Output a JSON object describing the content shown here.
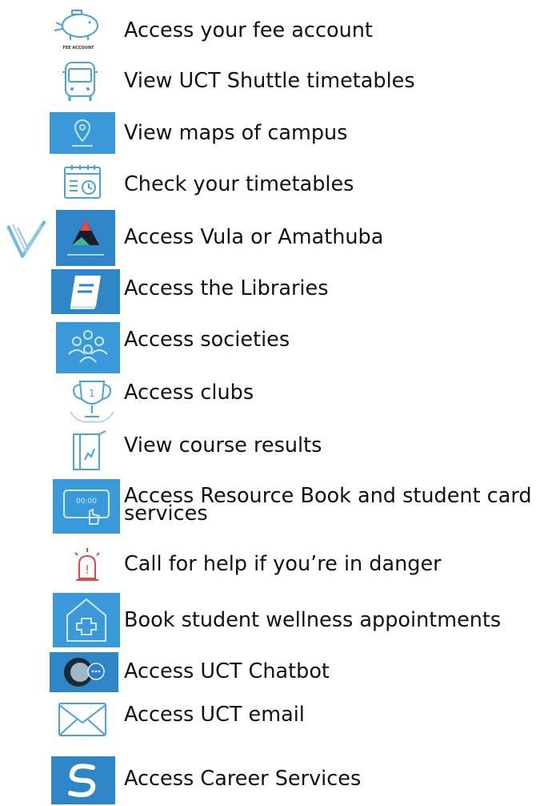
{
  "items": [
    {
      "label": "Access your fee account",
      "icon": "piggy-bank-icon",
      "icon_caption": "FEE ACCOUNT"
    },
    {
      "label": "View UCT Shuttle timetables",
      "icon": "bus-icon"
    },
    {
      "label": "View maps of campus",
      "icon": "map-pin-icon"
    },
    {
      "label": "Check your timetables",
      "icon": "calendar-clock-icon"
    },
    {
      "label": "Access Vula or Amathuba",
      "icon": "amathuba-app-icon"
    },
    {
      "label": "Access the Libraries",
      "icon": "book-icon"
    },
    {
      "label": "Access societies",
      "icon": "people-group-icon"
    },
    {
      "label": "Access clubs",
      "icon": "trophy-icon"
    },
    {
      "label": "View course results",
      "icon": "results-chart-icon"
    },
    {
      "label": "Access Resource Book and student card services",
      "icon": "card-tap-icon"
    },
    {
      "label": "Call for help if you’re in danger",
      "icon": "alarm-icon"
    },
    {
      "label": "Book student wellness appointments",
      "icon": "health-house-icon"
    },
    {
      "label": "Access UCT Chatbot",
      "icon": "chatbot-icon"
    },
    {
      "label": "Access UCT email",
      "icon": "email-icon"
    },
    {
      "label": "Access Career Services",
      "icon": "career-services-icon"
    }
  ],
  "colors": {
    "icon_blue": "#3a9ad9",
    "icon_light": "#5fb3e6",
    "text": "#111111",
    "alarm": "#e04848"
  }
}
